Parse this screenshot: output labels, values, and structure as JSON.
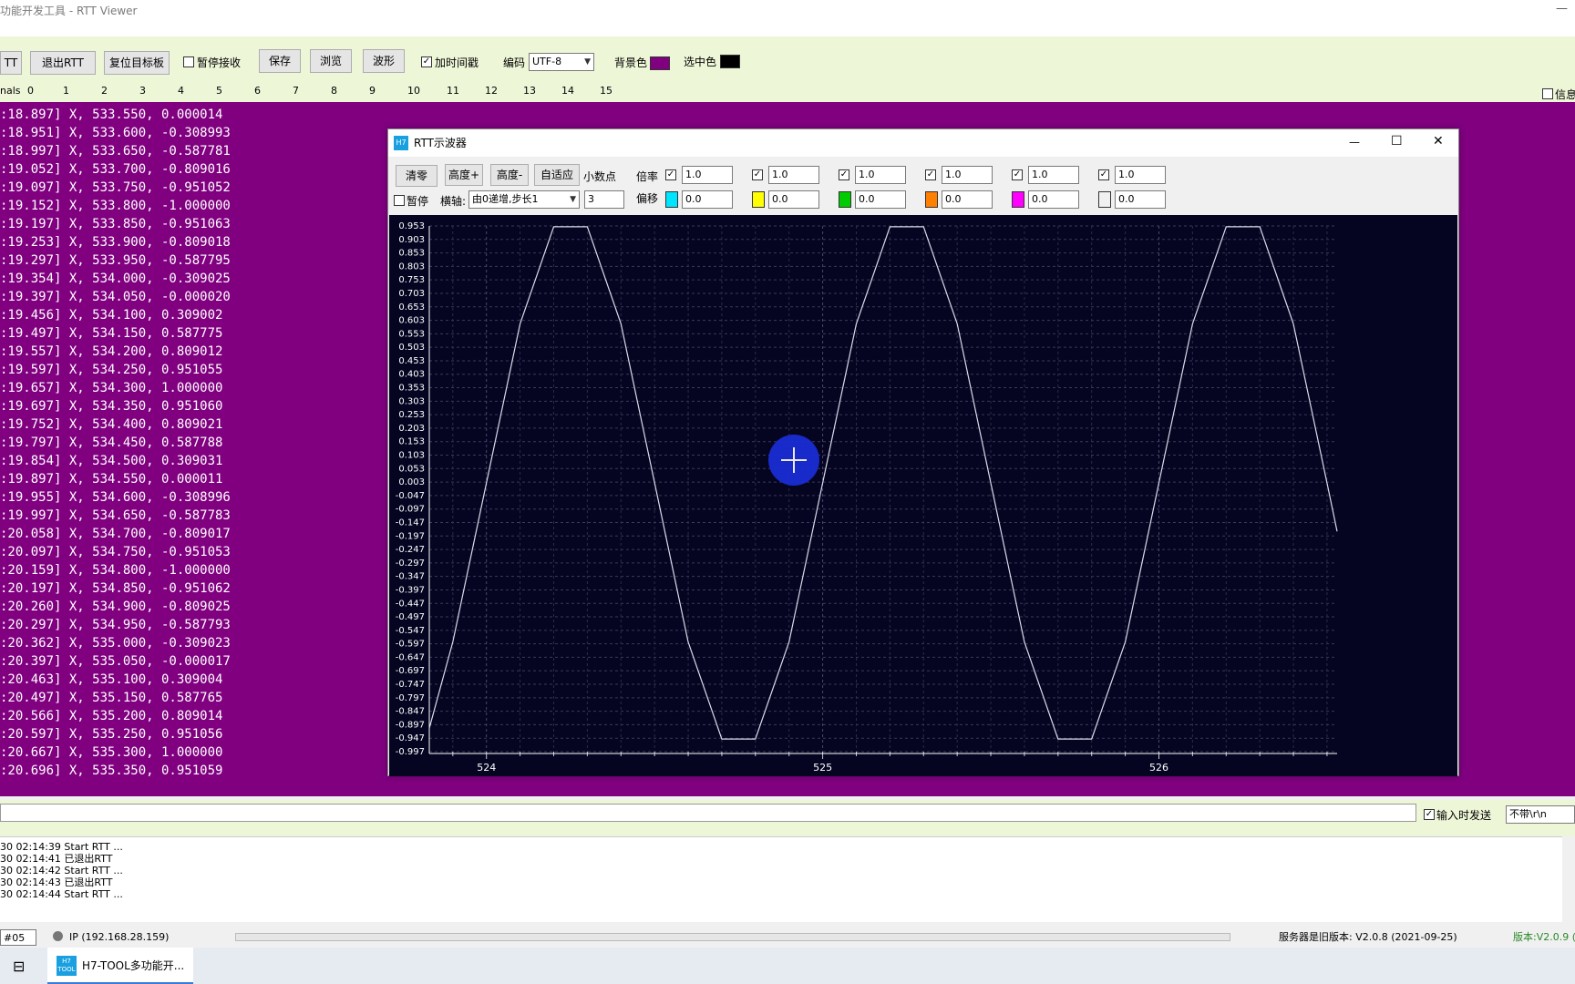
{
  "app": {
    "title": "功能开发工具 - RTT Viewer",
    "minimize_glyph": "—"
  },
  "toolbar": {
    "btn_rtt": "TT",
    "btn_exit": "退出RTT",
    "btn_reset": "复位目标板",
    "pause_recv": "暂停接收",
    "btn_save": "保存",
    "btn_browse": "浏览",
    "btn_wave": "波形",
    "timestamp": "加时间戳",
    "encoding_label": "编码",
    "encoding_value": "UTF-8",
    "bg_label": "背景色",
    "bg_color": "#800080",
    "sel_label": "选中色",
    "sel_color": "#000000",
    "info_label": "信息"
  },
  "ruler": {
    "label": "nals",
    "ticks": [
      "0",
      "1",
      "2",
      "3",
      "4",
      "5",
      "6",
      "7",
      "8",
      "9",
      "10",
      "11",
      "12",
      "13",
      "14",
      "15"
    ]
  },
  "log_lines": [
    ":18.897] X, 533.550, 0.000014",
    ":18.951] X, 533.600, -0.308993",
    ":18.997] X, 533.650, -0.587781",
    ":19.052] X, 533.700, -0.809016",
    ":19.097] X, 533.750, -0.951052",
    ":19.152] X, 533.800, -1.000000",
    ":19.197] X, 533.850, -0.951063",
    ":19.253] X, 533.900, -0.809018",
    ":19.297] X, 533.950, -0.587795",
    ":19.354] X, 534.000, -0.309025",
    ":19.397] X, 534.050, -0.000020",
    ":19.456] X, 534.100, 0.309002",
    ":19.497] X, 534.150, 0.587775",
    ":19.557] X, 534.200, 0.809012",
    ":19.597] X, 534.250, 0.951055",
    ":19.657] X, 534.300, 1.000000",
    ":19.697] X, 534.350, 0.951060",
    ":19.752] X, 534.400, 0.809021",
    ":19.797] X, 534.450, 0.587788",
    ":19.854] X, 534.500, 0.309031",
    ":19.897] X, 534.550, 0.000011",
    ":19.955] X, 534.600, -0.308996",
    ":19.997] X, 534.650, -0.587783",
    ":20.058] X, 534.700, -0.809017",
    ":20.097] X, 534.750, -0.951053",
    ":20.159] X, 534.800, -1.000000",
    ":20.197] X, 534.850, -0.951062",
    ":20.260] X, 534.900, -0.809025",
    ":20.297] X, 534.950, -0.587793",
    ":20.362] X, 535.000, -0.309023",
    ":20.397] X, 535.050, -0.000017",
    ":20.463] X, 535.100, 0.309004",
    ":20.497] X, 535.150, 0.587765",
    ":20.566] X, 535.200, 0.809014",
    ":20.597] X, 535.250, 0.951056",
    ":20.667] X, 535.300, 1.000000",
    ":20.696] X, 535.350, 0.951059"
  ],
  "send": {
    "on_input_label": "输入时发送",
    "ending_value": "不带\\r\\n"
  },
  "sys_log": [
    "30 02:14:39 Start RTT ...",
    "30 02:14:41 已退出RTT",
    "30 02:14:42 Start RTT ...",
    "30 02:14:43 已退出RTT",
    "30 02:14:44 Start RTT ..."
  ],
  "status": {
    "port": "#05",
    "ip": "IP (192.168.28.159)",
    "server_msg": "服务器是旧版本: V2.0.8 (2021-09-25)",
    "version": "版本:V2.0.9 ("
  },
  "taskbar": {
    "app_label": "H7-TOOL多功能开...",
    "app_icon_text": "H7\nTOOL"
  },
  "scope": {
    "icon_text": "H7",
    "title": "RTT示波器",
    "btn_clear": "清零",
    "btn_h_plus": "高度+",
    "btn_h_minus": "高度-",
    "btn_auto": "自适应",
    "decimals_label": "小数点",
    "decimals_value": "3",
    "pause_label": "暂停",
    "xaxis_label": "横轴:",
    "xaxis_value": "由0递增,步长1",
    "scale_label": "倍率",
    "offset_label": "偏移",
    "scale_values": [
      "1.0",
      "1.0",
      "1.0",
      "1.0",
      "1.0",
      "1.0"
    ],
    "offset_values": [
      "0.0",
      "0.0",
      "0.0",
      "0.0",
      "0.0",
      "0.0"
    ],
    "channel_colors": [
      "#00e5ff",
      "#ffff00",
      "#00cc00",
      "#ff8000",
      "#ff00ff",
      "#f0f0f0"
    ],
    "btn_min": "—",
    "btn_max": "☐",
    "btn_close": "✕"
  },
  "chart_data": {
    "type": "line",
    "x_range": [
      523.83,
      526.53
    ],
    "y_range": [
      -0.997,
      0.953
    ],
    "y_ticks": [
      "0.953",
      "0.903",
      "0.853",
      "0.803",
      "0.753",
      "0.703",
      "0.653",
      "0.603",
      "0.553",
      "0.503",
      "0.453",
      "0.403",
      "0.353",
      "0.303",
      "0.253",
      "0.203",
      "0.153",
      "0.103",
      "0.053",
      "0.003",
      "-0.047",
      "-0.097",
      "-0.147",
      "-0.197",
      "-0.247",
      "-0.297",
      "-0.347",
      "-0.397",
      "-0.447",
      "-0.497",
      "-0.547",
      "-0.597",
      "-0.647",
      "-0.697",
      "-0.747",
      "-0.797",
      "-0.847",
      "-0.897",
      "-0.947",
      "-0.997"
    ],
    "x_ticks": [
      "524",
      "525",
      "526"
    ],
    "series": [
      {
        "color": "#d8dcea",
        "x": [
          523.83,
          523.9,
          524.0,
          524.1,
          524.2,
          524.3,
          524.4,
          524.5,
          524.6,
          524.7,
          524.8,
          524.9,
          525.0,
          525.1,
          525.2,
          525.3,
          525.4,
          525.5,
          525.6,
          525.7,
          525.8,
          525.9,
          526.0,
          526.1,
          526.2,
          526.3,
          526.4,
          526.5,
          526.53
        ],
        "y": [
          -0.91,
          -0.59,
          0.0,
          0.59,
          0.95,
          0.95,
          0.59,
          0.0,
          -0.59,
          -0.95,
          -0.95,
          -0.59,
          0.0,
          0.59,
          0.95,
          0.95,
          0.59,
          0.0,
          -0.59,
          -0.95,
          -0.95,
          -0.59,
          0.0,
          0.59,
          0.95,
          0.95,
          0.59,
          0.0,
          -0.18
        ]
      }
    ]
  }
}
